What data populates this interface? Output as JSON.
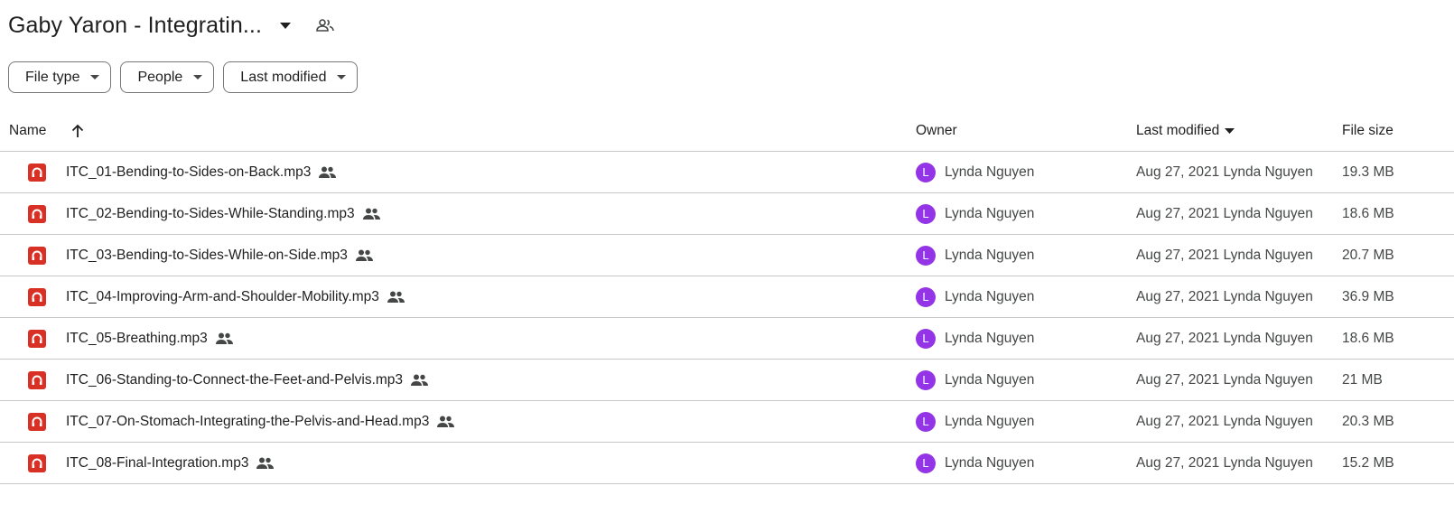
{
  "header": {
    "title": "Gaby Yaron - Integratin..."
  },
  "filters": [
    {
      "label": "File type"
    },
    {
      "label": "People"
    },
    {
      "label": "Last modified"
    }
  ],
  "columns": {
    "name": "Name",
    "owner": "Owner",
    "modified": "Last modified",
    "size": "File size"
  },
  "icons": {
    "file": "audio-file-icon",
    "shared": "shared-people-icon",
    "sort": "arrow-up-icon"
  },
  "colors": {
    "audio_icon": "#d93025",
    "avatar": "#9334e6",
    "border": "#c7c7c7"
  },
  "rows": [
    {
      "name": "ITC_01-Bending-to-Sides-on-Back.mp3",
      "avatar": "L",
      "owner": "Lynda Nguyen",
      "modified": "Aug 27, 2021 Lynda Nguyen",
      "size": "19.3 MB"
    },
    {
      "name": "ITC_02-Bending-to-Sides-While-Standing.mp3",
      "avatar": "L",
      "owner": "Lynda Nguyen",
      "modified": "Aug 27, 2021 Lynda Nguyen",
      "size": "18.6 MB"
    },
    {
      "name": "ITC_03-Bending-to-Sides-While-on-Side.mp3",
      "avatar": "L",
      "owner": "Lynda Nguyen",
      "modified": "Aug 27, 2021 Lynda Nguyen",
      "size": "20.7 MB"
    },
    {
      "name": "ITC_04-Improving-Arm-and-Shoulder-Mobility.mp3",
      "avatar": "L",
      "owner": "Lynda Nguyen",
      "modified": "Aug 27, 2021 Lynda Nguyen",
      "size": "36.9 MB"
    },
    {
      "name": "ITC_05-Breathing.mp3",
      "avatar": "L",
      "owner": "Lynda Nguyen",
      "modified": "Aug 27, 2021 Lynda Nguyen",
      "size": "18.6 MB"
    },
    {
      "name": "ITC_06-Standing-to-Connect-the-Feet-and-Pelvis.mp3",
      "avatar": "L",
      "owner": "Lynda Nguyen",
      "modified": "Aug 27, 2021 Lynda Nguyen",
      "size": "21 MB"
    },
    {
      "name": "ITC_07-On-Stomach-Integrating-the-Pelvis-and-Head.mp3",
      "avatar": "L",
      "owner": "Lynda Nguyen",
      "modified": "Aug 27, 2021 Lynda Nguyen",
      "size": "20.3 MB"
    },
    {
      "name": "ITC_08-Final-Integration.mp3",
      "avatar": "L",
      "owner": "Lynda Nguyen",
      "modified": "Aug 27, 2021 Lynda Nguyen",
      "size": "15.2 MB"
    }
  ]
}
